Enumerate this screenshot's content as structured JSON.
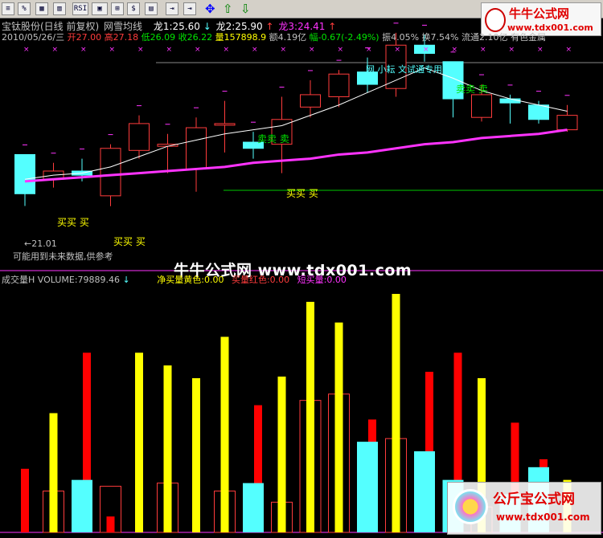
{
  "toolbar": {
    "buttons": [
      "≡",
      "%",
      "▦",
      "▥",
      "RSI",
      "▣",
      "⊞",
      "$",
      "▤",
      "⇥"
    ],
    "arrows": [
      "✥",
      "⇧",
      "⇩"
    ]
  },
  "watermark_top": {
    "title": "牛牛公式网",
    "url": "www.tdx001.com"
  },
  "header": {
    "stock": "宝钛股份(日线 前复权)",
    "indicator": "网雪均线",
    "dragon1": "龙1:25.60",
    "dragon2": "龙2:25.90",
    "dragon3": "龙3:24.41",
    "date": "2010/05/26/三",
    "open": "开27.00",
    "high": "高27.18",
    "low": "低26.09",
    "close": "收26.22",
    "volume": "量157898.9",
    "amount": "额4.19亿",
    "change": "幅-0.67(-2.49%)",
    "amplitude": "振4.05%",
    "turnover": "换7.54%",
    "float": "流通2.10亿",
    "sector": "有色金属"
  },
  "annotations": {
    "price_low": "←21.01",
    "notice": "可能用到未来数据,供参考",
    "special": "网 小耘 文试通专用",
    "buy": "买买 买",
    "sell": "卖卖 卖"
  },
  "center_watermark": "牛牛公式网 www.tdx001.com",
  "volume_panel": {
    "title": "成交量H VOLUME:79889.46",
    "yellow": "净买量黄色:0.00",
    "red": "买量红色:0.00",
    "magenta": "短买量:0.00"
  },
  "watermark_bottom": {
    "title": "公斤宝公式网",
    "url": "www.tdx001.com"
  },
  "colors": {
    "up": "#ff3c3c",
    "down": "#54ffff",
    "ma": "#ffffff",
    "ma_long": "#ff33ff",
    "buy": "#ffff00",
    "red": "#ff0000",
    "cyan": "#54ffff",
    "magenta": "#ff33ff",
    "green": "#00ff00"
  },
  "chart_data": {
    "type": "candlestick",
    "candles": [
      {
        "o": 23.5,
        "c": 21.6,
        "h": 23.5,
        "l": 21.01
      },
      {
        "o": 22.3,
        "c": 22.7,
        "h": 23.1,
        "l": 21.9
      },
      {
        "o": 22.7,
        "c": 22.5,
        "h": 23.3,
        "l": 22.2
      },
      {
        "o": 21.5,
        "c": 23.8,
        "h": 24.0,
        "l": 21.0
      },
      {
        "o": 23.7,
        "c": 25.0,
        "h": 25.4,
        "l": 23.3
      },
      {
        "o": 23.9,
        "c": 24.0,
        "h": 24.5,
        "l": 22.6
      },
      {
        "o": 22.8,
        "c": 24.8,
        "h": 25.3,
        "l": 21.7
      },
      {
        "o": 25.0,
        "c": 25.0,
        "h": 26.1,
        "l": 23.6
      },
      {
        "o": 24.1,
        "c": 23.8,
        "h": 24.6,
        "l": 23.3
      },
      {
        "o": 24.0,
        "c": 25.2,
        "h": 26.3,
        "l": 22.6
      },
      {
        "o": 25.8,
        "c": 26.4,
        "h": 27.1,
        "l": 25.3
      },
      {
        "o": 26.3,
        "c": 27.4,
        "h": 27.6,
        "l": 25.8
      },
      {
        "o": 27.5,
        "c": 26.9,
        "h": 28.2,
        "l": 26.5
      },
      {
        "o": 26.7,
        "c": 28.8,
        "h": 29.4,
        "l": 26.3
      },
      {
        "o": 28.8,
        "c": 28.4,
        "h": 29.3,
        "l": 28.0
      },
      {
        "o": 28.0,
        "c": 26.2,
        "h": 28.0,
        "l": 25.3
      },
      {
        "o": 25.3,
        "c": 26.4,
        "h": 26.9,
        "l": 25.1
      },
      {
        "o": 26.2,
        "c": 26.0,
        "h": 26.4,
        "l": 25.0
      },
      {
        "o": 25.9,
        "c": 25.2,
        "h": 26.1,
        "l": 25.0
      },
      {
        "o": 24.7,
        "c": 25.4,
        "h": 25.9,
        "l": 24.6
      }
    ],
    "ma_short": [
      22.3,
      22.5,
      22.6,
      22.9,
      23.4,
      23.9,
      24.2,
      24.5,
      24.7,
      24.9,
      25.4,
      25.9,
      26.5,
      27.1,
      27.7,
      27.2,
      26.6,
      26.2,
      25.9,
      25.6
    ],
    "ma_long": [
      22.2,
      22.3,
      22.4,
      22.5,
      22.6,
      22.7,
      22.8,
      22.9,
      23.1,
      23.2,
      23.3,
      23.5,
      23.6,
      23.8,
      24.0,
      24.1,
      24.3,
      24.4,
      24.5,
      24.7
    ],
    "volume": [
      {
        "cyan": 0,
        "red": 4.0,
        "yellow": 0
      },
      {
        "cyan": 0,
        "red": 1.0,
        "yellow": 7.5
      },
      {
        "cyan": 3.3,
        "red": 11.3,
        "yellow": 0
      },
      {
        "cyan": 0,
        "red": 1.0,
        "yellow": 0
      },
      {
        "cyan": 0,
        "red": 0,
        "yellow": 11.3
      },
      {
        "cyan": 0,
        "red": 0,
        "yellow": 10.5
      },
      {
        "cyan": 0,
        "red": 0,
        "yellow": 9.7
      },
      {
        "cyan": 0,
        "red": 0,
        "yellow": 12.3
      },
      {
        "cyan": 3.1,
        "red": 8.0,
        "yellow": 0
      },
      {
        "cyan": 0,
        "red": 0,
        "yellow": 9.8
      },
      {
        "cyan": 0,
        "red": 0,
        "yellow": 14.5
      },
      {
        "cyan": 0,
        "red": 0,
        "yellow": 13.2
      },
      {
        "cyan": 5.7,
        "red": 7.1,
        "yellow": 0
      },
      {
        "cyan": 0,
        "red": 0,
        "yellow": 15.0
      },
      {
        "cyan": 5.1,
        "red": 10.1,
        "yellow": 0
      },
      {
        "cyan": 3.3,
        "red": 11.3,
        "yellow": 0
      },
      {
        "cyan": 0,
        "red": 0,
        "yellow": 9.7
      },
      {
        "cyan": 2.4,
        "red": 6.9,
        "yellow": 0
      },
      {
        "cyan": 4.1,
        "red": 4.6,
        "yellow": 0
      },
      {
        "cyan": 0,
        "red": 0,
        "yellow": 3.3
      }
    ],
    "volume_outline": [
      0,
      2.6,
      0,
      2.9,
      0,
      3.1,
      0,
      2.6,
      0,
      1.9,
      8.3,
      8.7,
      0,
      5.9,
      0,
      0,
      1.6,
      0,
      0,
      0
    ]
  }
}
